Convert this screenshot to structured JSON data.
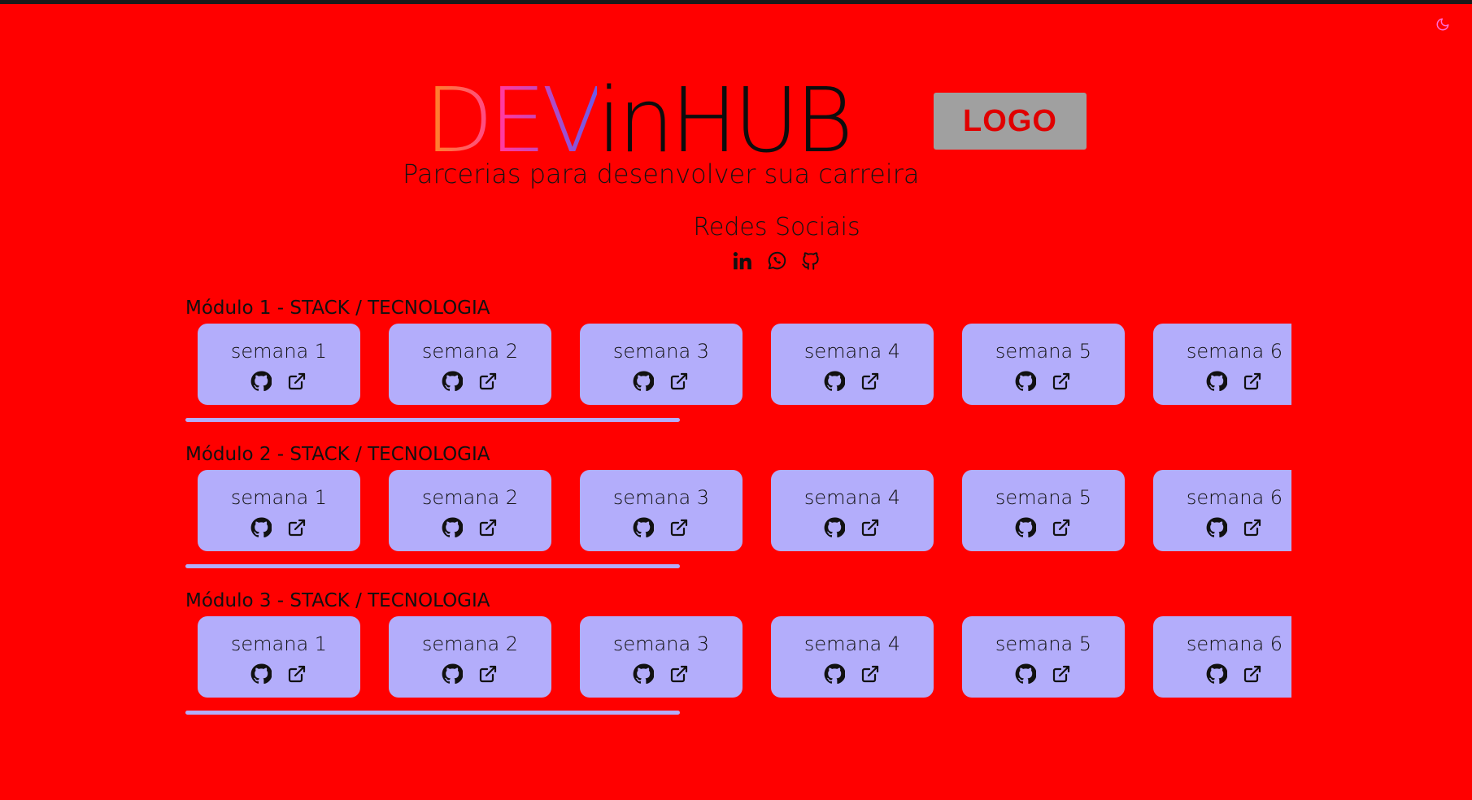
{
  "header": {
    "brand_dev": "DEV",
    "brand_rest": "inHUB",
    "tagline": "Parcerias para desenvolver sua carreira",
    "logo_label": "LOGO"
  },
  "theme_toggle": {
    "icon": "moon-icon"
  },
  "social": {
    "title": "Redes Sociais",
    "icons": [
      "linkedin-icon",
      "whatsapp-icon",
      "github-icon"
    ]
  },
  "modules": [
    {
      "title": "Módulo 1 - STACK / TECNOLOGIA",
      "weeks": [
        "semana 1",
        "semana 2",
        "semana 3",
        "semana 4",
        "semana 5",
        "semana 6"
      ]
    },
    {
      "title": "Módulo 2 - STACK / TECNOLOGIA",
      "weeks": [
        "semana 1",
        "semana 2",
        "semana 3",
        "semana 4",
        "semana 5",
        "semana 6"
      ]
    },
    {
      "title": "Módulo 3 - STACK / TECNOLOGIA",
      "weeks": [
        "semana 1",
        "semana 2",
        "semana 3",
        "semana 4",
        "semana 5",
        "semana 6"
      ]
    }
  ],
  "card_icons": [
    "github-icon",
    "external-link-icon"
  ],
  "colors": {
    "background": "#ff0000",
    "card": "#b3adfb",
    "logo_box": "#a0a0a0",
    "logo_text": "#e00000",
    "toggle": "#ff6bd6"
  }
}
